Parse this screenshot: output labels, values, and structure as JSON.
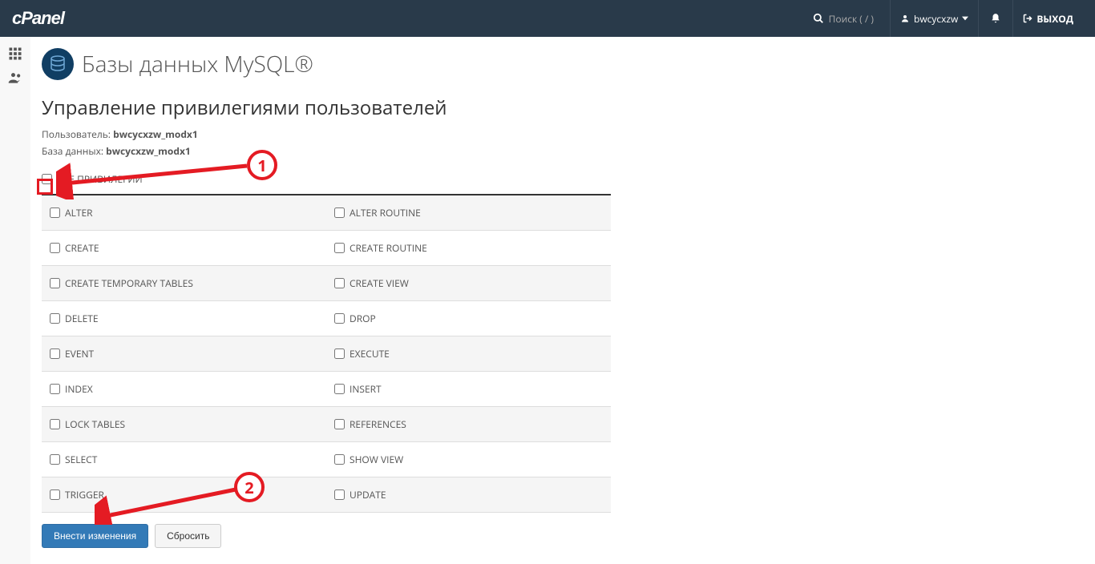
{
  "header": {
    "logo": "cPanel",
    "search_placeholder": "Поиск ( / )",
    "username": "bwcycxzw",
    "logout": "ВЫХОД"
  },
  "page": {
    "title": "Базы данных MySQL®",
    "section_title": "Управление привилегиями пользователей",
    "user_label": "Пользователь:",
    "user_value": "bwcycxzw_modx1",
    "db_label": "База данных:",
    "db_value": "bwcycxzw_modx1"
  },
  "privileges": {
    "all_label": "ВСЕ ПРИВИЛЕГИИ",
    "rows": [
      {
        "left": "ALTER",
        "right": "ALTER ROUTINE"
      },
      {
        "left": "CREATE",
        "right": "CREATE ROUTINE"
      },
      {
        "left": "CREATE TEMPORARY TABLES",
        "right": "CREATE VIEW"
      },
      {
        "left": "DELETE",
        "right": "DROP"
      },
      {
        "left": "EVENT",
        "right": "EXECUTE"
      },
      {
        "left": "INDEX",
        "right": "INSERT"
      },
      {
        "left": "LOCK TABLES",
        "right": "REFERENCES"
      },
      {
        "left": "SELECT",
        "right": "SHOW VIEW"
      },
      {
        "left": "TRIGGER",
        "right": "UPDATE"
      }
    ]
  },
  "buttons": {
    "submit": "Внести изменения",
    "reset": "Сбросить"
  },
  "annotations": {
    "marker1": "1",
    "marker2": "2"
  }
}
